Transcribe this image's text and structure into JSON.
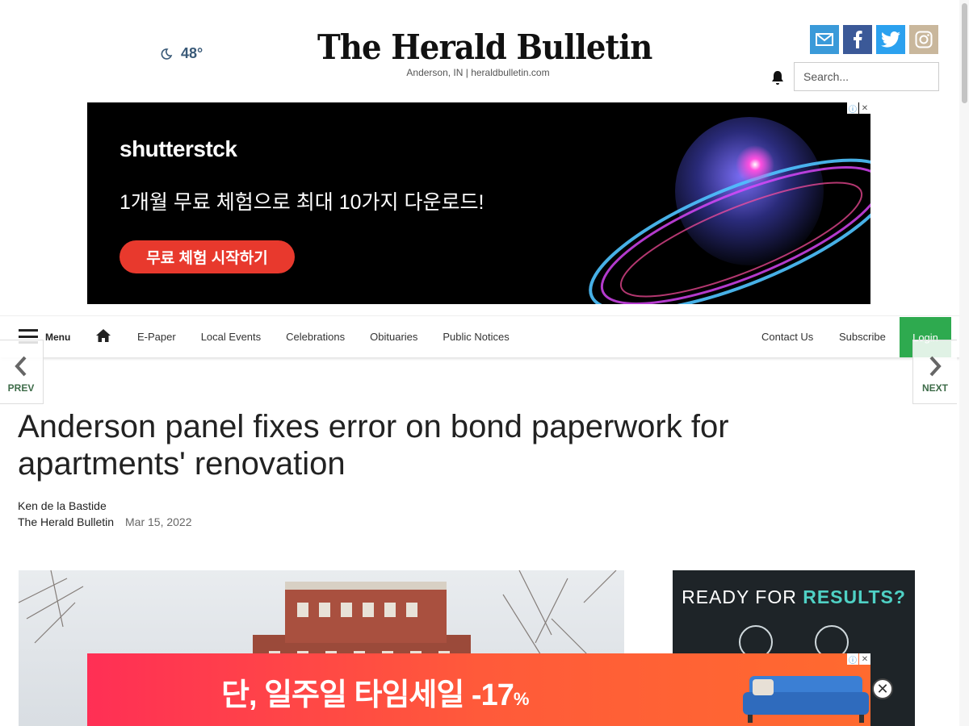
{
  "weather": {
    "icon": "moon-icon",
    "temp": "48°"
  },
  "masthead": {
    "title": "The Herald Bulletin",
    "subtitle": "Anderson, IN | heraldbulletin.com"
  },
  "social": [
    {
      "name": "email-icon",
      "color": "#3a9ad9"
    },
    {
      "name": "facebook-icon",
      "color": "#3b5998"
    },
    {
      "name": "twitter-icon",
      "color": "#2ba1ef"
    },
    {
      "name": "instagram-icon",
      "color": "#c9b79c"
    }
  ],
  "search": {
    "placeholder": "Search..."
  },
  "ad_top": {
    "brand": "shutterstck",
    "headline": "1개월 무료 체험으로 최대 10가지 다운로드!",
    "cta": "무료 체험 시작하기"
  },
  "nav": {
    "menu_label": "Menu",
    "links": [
      "E-Paper",
      "Local Events",
      "Celebrations",
      "Obituaries",
      "Public Notices"
    ],
    "contact": "Contact Us",
    "subscribe": "Subscribe",
    "login": "Login"
  },
  "pager": {
    "prev": "PREV",
    "next": "NEXT"
  },
  "article": {
    "title": "Anderson panel fixes error on bond paperwork for apartments' renovation",
    "author": "Ken de la Bastide",
    "source": "The Herald Bulletin",
    "date": "Mar 15, 2022"
  },
  "side_ad": {
    "lead": "READY FOR ",
    "accent": "RESULTS?"
  },
  "ad_bottom": {
    "text": "단, 일주일 타임세일 -17",
    "pct": "%"
  },
  "colors": {
    "login_green": "#2eaa4f",
    "accent_green": "#3d6b48"
  }
}
